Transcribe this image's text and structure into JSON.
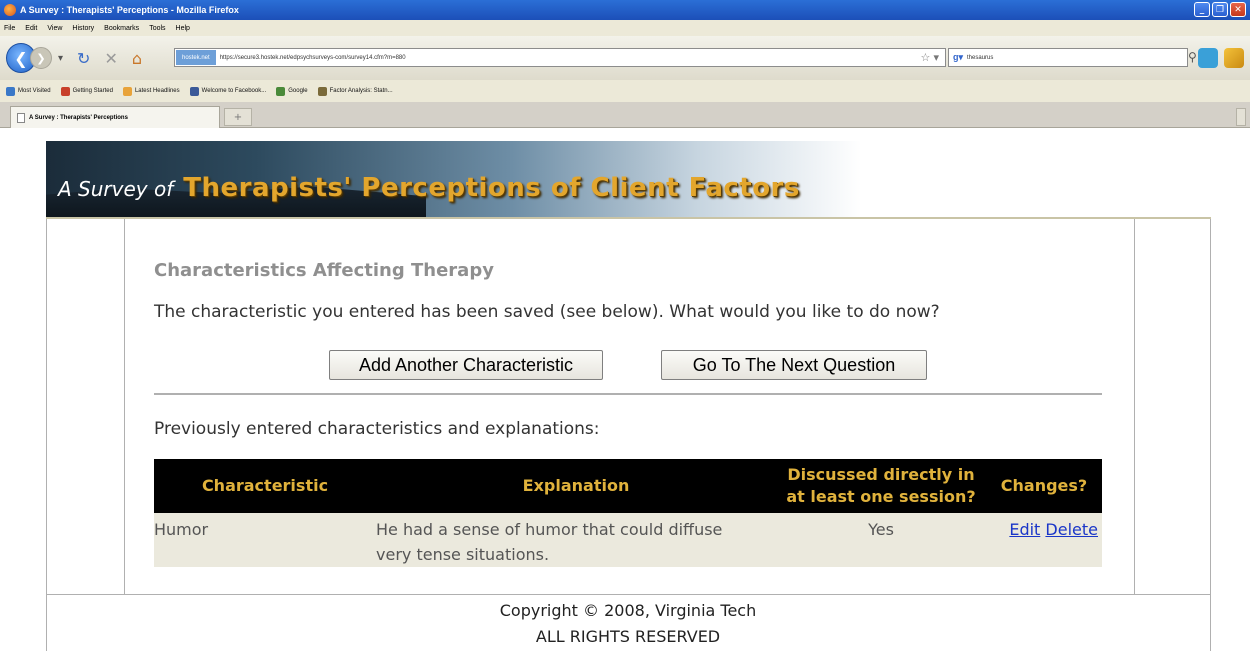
{
  "window": {
    "title": "A Survey : Therapists' Perceptions - Mozilla Firefox",
    "buttons": [
      "_",
      "❐",
      "✕"
    ]
  },
  "menu": [
    "File",
    "Edit",
    "View",
    "History",
    "Bookmarks",
    "Tools",
    "Help"
  ],
  "navbar": {
    "site_badge": "hostek.net",
    "url": "https://secure3.hostek.net/edpsychsurveys-com/survey14.cfm?m=880",
    "search_value": "thesaurus"
  },
  "bookmarks": [
    {
      "label": "Most Visited",
      "color": "#3a78c8"
    },
    {
      "label": "Getting Started",
      "color": "#c8402a"
    },
    {
      "label": "Latest Headlines",
      "color": "#e8a33a"
    },
    {
      "label": "Welcome to Facebook...",
      "color": "#3b5998"
    },
    {
      "label": "Google",
      "color": "#4a8a3a"
    },
    {
      "label": "Factor Analysis: Statn...",
      "color": "#7a6a3a"
    }
  ],
  "tab": {
    "label": "A Survey : Therapists' Perceptions"
  },
  "banner": {
    "prefix": "A Survey of",
    "title": "Therapists' Perceptions of Client Factors"
  },
  "section_title": "Characteristics Affecting Therapy",
  "message": "The characteristic you entered has been saved (see below). What would you like to do now?",
  "buttons": {
    "add": "Add Another Characteristic",
    "next": "Go To The Next Question"
  },
  "previous_label": "Previously entered characteristics and explanations:",
  "table": {
    "headers": {
      "characteristic": "Characteristic",
      "explanation": "Explanation",
      "discussed_line1": "Discussed directly in",
      "discussed_line2": "at least one session?",
      "changes": "Changes?"
    },
    "rows": [
      {
        "characteristic": "Humor",
        "explanation_line1": "He had a sense of humor that could diffuse",
        "explanation_line2": "very tense situations.",
        "discussed": "Yes",
        "edit": "Edit",
        "delete": "Delete"
      }
    ]
  },
  "footer": {
    "copyright": "Copyright © 2008, Virginia Tech",
    "rights": "ALL RIGHTS RESERVED"
  },
  "colors": {
    "banner_title": "#e3a62d",
    "table_header_bg": "#000000",
    "table_header_text": "#e0b23c",
    "table_row_bg": "#ebe9dd",
    "link": "#1a36c8"
  }
}
